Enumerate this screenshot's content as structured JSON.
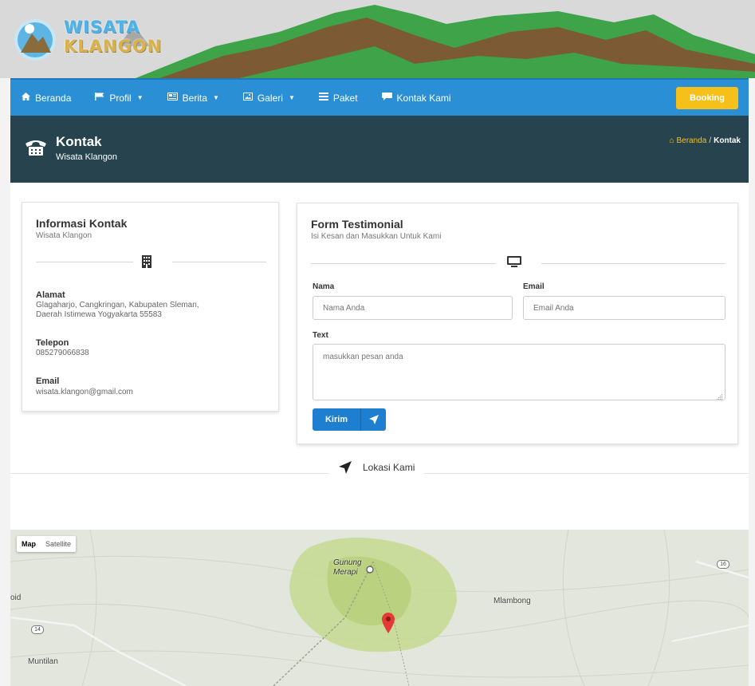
{
  "logo": {
    "line1": "WISATA",
    "line2": "KLANGON"
  },
  "nav": {
    "items": [
      {
        "label": "Beranda",
        "icon": "home-icon",
        "caret": false
      },
      {
        "label": "Profil",
        "icon": "flag-icon",
        "caret": true
      },
      {
        "label": "Berita",
        "icon": "newspaper-icon",
        "caret": true
      },
      {
        "label": "Galeri",
        "icon": "picture-icon",
        "caret": true
      },
      {
        "label": "Paket",
        "icon": "list-icon",
        "caret": false
      },
      {
        "label": "Kontak Kami",
        "icon": "chat-icon",
        "caret": false
      }
    ],
    "booking_label": "Booking"
  },
  "page_header": {
    "title": "Kontak",
    "subtitle": "Wisata Klangon",
    "breadcrumb_home": "Beranda",
    "breadcrumb_sep": "/",
    "breadcrumb_current": "Kontak"
  },
  "contact_info": {
    "title": "Informasi Kontak",
    "subtitle": "Wisata Klangon",
    "address_label": "Alamat",
    "address_line1": "Glagaharjo, Cangkringan, Kabupaten Sleman,",
    "address_line2": "Daerah Istimewa Yogyakarta 55583",
    "phone_label": "Telepon",
    "phone": "085279066838",
    "email_label": "Email",
    "email": "wisata.klangon@gmail.com"
  },
  "testimonial_form": {
    "title": "Form Testimonial",
    "subtitle": "Isi Kesan dan Masukkan Untuk Kami",
    "name_label": "Nama",
    "name_placeholder": "Nama Anda",
    "email_label": "Email",
    "email_placeholder": "Email Anda",
    "text_label": "Text",
    "text_placeholder": "masukkan pesan anda",
    "submit_label": "Kirim"
  },
  "location": {
    "label": "Lokasi Kami"
  },
  "map": {
    "map_tab": "Map",
    "satellite_tab": "Satellite",
    "place_gunung": "Gunung",
    "place_merapi": "Merapi",
    "place_mlambong": "Mlambong",
    "place_muntilan": "Muntilan",
    "road_14": "14",
    "road_16": "16",
    "edge_label": "oid"
  },
  "colors": {
    "nav_blue": "#2b8fd6",
    "header_dark": "#27434e",
    "booking_yellow": "#f6c01a",
    "button_blue": "#1e7fd0",
    "pin_red": "#e53935"
  }
}
